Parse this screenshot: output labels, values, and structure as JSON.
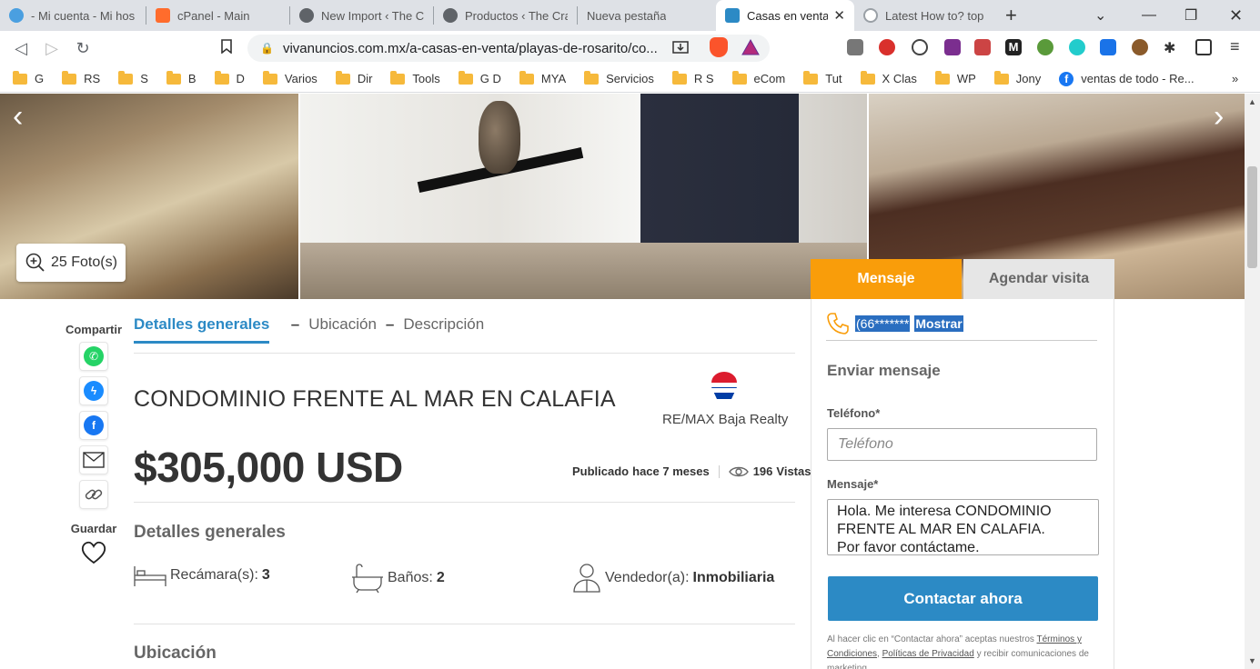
{
  "browser": {
    "tabs": [
      {
        "title": "- Mi cuenta - Mi hos",
        "color": "#4a9fe0"
      },
      {
        "title": "cPanel - Main",
        "color": "#ff6c2c"
      },
      {
        "title": "New Import ‹ The Cr",
        "color": "#5f6368"
      },
      {
        "title": "Productos ‹ The Cra",
        "color": "#5f6368"
      },
      {
        "title": "Nueva pestaña",
        "color": ""
      },
      {
        "title": "Casas en venta",
        "color": "#2c8ac5",
        "active": true
      },
      {
        "title": "Latest How to? topi",
        "color": "#9aa0a6"
      }
    ],
    "url": "vivanuncios.com.mx/a-casas-en-venta/playas-de-rosarito/co...",
    "bookmarks": [
      "G",
      "RS",
      "S",
      "B",
      "D",
      "Varios",
      "Dir",
      "Tools",
      "G D",
      "MYA",
      "Servicios",
      "R S",
      "eCom",
      "Tut",
      "X Clas",
      "WP",
      "Jony"
    ],
    "bookmark_fb": "ventas de todo - Re...",
    "more": "»"
  },
  "gallery": {
    "photos_label": "25 Foto(s)"
  },
  "share": {
    "label": "Compartir",
    "save_label": "Guardar"
  },
  "subnav": {
    "items": [
      "Detalles generales",
      "Ubicación",
      "Descripción"
    ]
  },
  "listing": {
    "title": "CONDOMINIO FRENTE AL MAR EN CALAFIA",
    "agency": "RE/MAX Baja Realty",
    "price": "$305,000 USD",
    "published_label": "Publicado",
    "published_value": "hace 7 meses",
    "views_count": "196",
    "views_label": "Vistas",
    "details_heading": "Detalles generales",
    "location_heading": "Ubicación",
    "features": [
      {
        "label": "Recámara(s):",
        "value": "3"
      },
      {
        "label": "Baños:",
        "value": "2"
      },
      {
        "label": "Vendedor(a):",
        "value": "Inmobiliaria"
      }
    ]
  },
  "contact": {
    "tab_message": "Mensaje",
    "tab_visit": "Agendar visita",
    "phone_masked": "(66*******",
    "show_label": "Mostrar",
    "send_heading": "Enviar mensaje",
    "phone_label": "Teléfono*",
    "phone_placeholder": "Teléfono",
    "message_label": "Mensaje*",
    "message_value": "Hola. Me interesa CONDOMINIO FRENTE AL MAR EN CALAFIA.\nPor favor contáctame.",
    "cta_label": "Contactar ahora",
    "legal_prefix": "Al hacer clic en “Contactar ahora” aceptas nuestros",
    "legal_terms": "Términos y Condiciones",
    "legal_privacy": "Políticas de Privacidad",
    "legal_suffix": "y recibir comunicaciones de marketing"
  },
  "colors": {
    "accent": "#2c8ac5",
    "orange": "#f99d0a"
  }
}
